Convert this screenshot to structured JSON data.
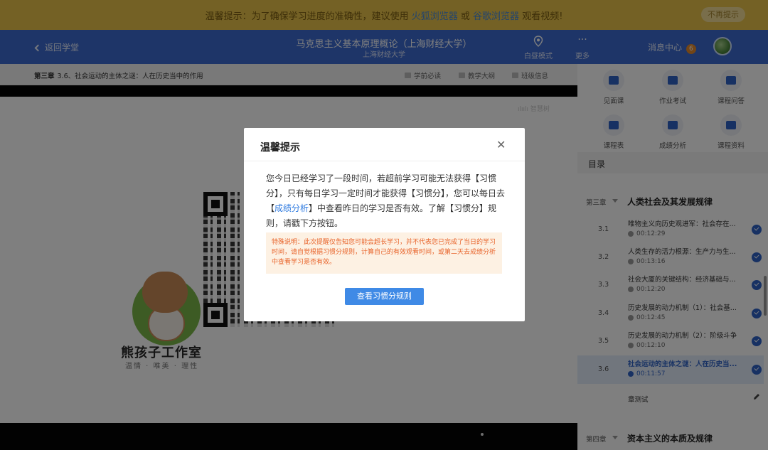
{
  "banner": {
    "prefix": "温馨提示：为了确保学习进度的准确性，建议使用",
    "firefox": "火狐浏览器",
    "or": "或",
    "chrome": "谷歌浏览器",
    "suffix": "观看视频!",
    "dismiss_label": "不再提示"
  },
  "header": {
    "back_label": "返回学堂",
    "course_title": "马克思主义基本原理概论（上海财经大学）",
    "course_school": "上海财经大学",
    "mode_label": "白昼模式",
    "more_label": "更多",
    "messages_label": "消息中心",
    "messages_count": "6"
  },
  "breadcrumb": {
    "chapter": "第三章",
    "lesson": "3.6、社会运动的主体之谜：人在历史当中的作用",
    "links": [
      "学前必读",
      "教学大纲",
      "班级信息"
    ]
  },
  "video": {
    "studio_name": "熊孩子工作室",
    "studio_tagline": "温情 · 唯美 · 理性",
    "watermark": "ılıılı 智慧树"
  },
  "tools": [
    {
      "label": "见面课",
      "icon": "meeting-class-icon"
    },
    {
      "label": "作业考试",
      "icon": "homework-exam-icon"
    },
    {
      "label": "课程问答",
      "icon": "course-qa-icon"
    },
    {
      "label": "课程表",
      "icon": "timetable-icon"
    },
    {
      "label": "成绩分析",
      "icon": "grade-analysis-icon"
    },
    {
      "label": "课程资料",
      "icon": "course-materials-icon"
    }
  ],
  "toc": {
    "heading": "目录",
    "chapters": [
      {
        "num": "第三章",
        "title": "人类社会及其发展规律"
      },
      {
        "num": "第四章",
        "title": "资本主义的本质及规律"
      }
    ],
    "lessons": [
      {
        "num": "3.1",
        "name": "唯物主义向历史观进军：社会存在...",
        "duration": "00:12:29"
      },
      {
        "num": "3.2",
        "name": "人类生存的活力根源：生产力与生...",
        "duration": "00:13:16"
      },
      {
        "num": "3.3",
        "name": "社会大厦的关键结构：经济基础与...",
        "duration": "00:12:20"
      },
      {
        "num": "3.4",
        "name": "历史发展的动力机制（1）：社会基...",
        "duration": "00:12:45"
      },
      {
        "num": "3.5",
        "name": "历史发展的动力机制（2）：阶级斗争",
        "duration": "00:12:10"
      },
      {
        "num": "3.6",
        "name": "社会运动的主体之谜：人在历史当...",
        "duration": "00:11:57"
      }
    ],
    "quiz_label": "章测试"
  },
  "dialog": {
    "title": "温馨提示",
    "body_1": "您今日已经学习了一段时间，若超前学习可能无法获得【习惯分】，只有每日学习一定时间才能获得【习惯分】，您可以每日去【",
    "body_link": "成绩分析",
    "body_2": "】中查看昨日的学习是否有效。了解【习惯分】规则，请戳下方按钮。",
    "note": "特殊说明：此次提醒仅告知您可能会超长学习，并不代表您已完成了当日的学习时间，请自觉根据习惯分规则，计算自己的有效观看时间，或第二天去成绩分析中查看学习是否有效。",
    "button_label": "查看习惯分规则"
  }
}
